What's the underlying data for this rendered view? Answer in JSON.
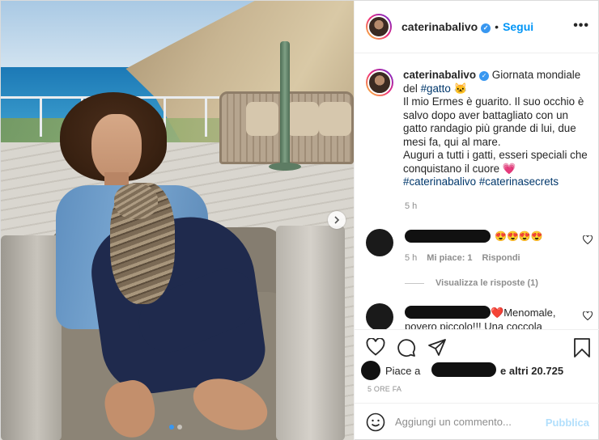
{
  "post": {
    "username": "caterinabalivo",
    "follow_label": "Segui",
    "more_label": "•••",
    "dot": "•"
  },
  "caption": {
    "username": "caterinabalivo",
    "line1": "Giornata mondiale del ",
    "hashtag_gatto": "#gatto",
    "emoji": "🐱",
    "line2": "Il mio Ermes è guarito. Il suo occhio è salvo dopo aver battagliato con un gatto randagio più grande di lui, due mesi fa, qui al mare.",
    "line3": "Auguri a tutti i gatti, esseri speciali che conquistano il cuore 💗",
    "hashtag1": "#caterinabalivo",
    "hashtag2": "#caterinasecrets",
    "time": "5 h"
  },
  "comments": [
    {
      "text": "😍😍😍😍",
      "time": "5 h",
      "likes_label": "Mi piace: 1",
      "reply_label": "Rispondi"
    },
    {
      "heart": "❤️",
      "text": "Menomale, povero piccolo!!!  Una coccola"
    }
  ],
  "replies_label": "Visualizza le risposte (1)",
  "likes": {
    "prefix": "Piace a",
    "suffix": "e altri 20.725"
  },
  "time_ago": "5 ORE FA",
  "add_comment": {
    "placeholder": "Aggiungi un commento...",
    "publish_label": "Pubblica"
  },
  "icons": {
    "heart": "heart-icon",
    "comment": "comment-icon",
    "share": "share-icon",
    "save": "bookmark-icon",
    "emoji": "emoji-icon",
    "next": "chevron-right-icon"
  },
  "colors": {
    "accent": "#0095f6",
    "publish_disabled": "#b2dffc",
    "verified": "#3897f0"
  },
  "carousel": {
    "current": 1,
    "total": 2
  }
}
